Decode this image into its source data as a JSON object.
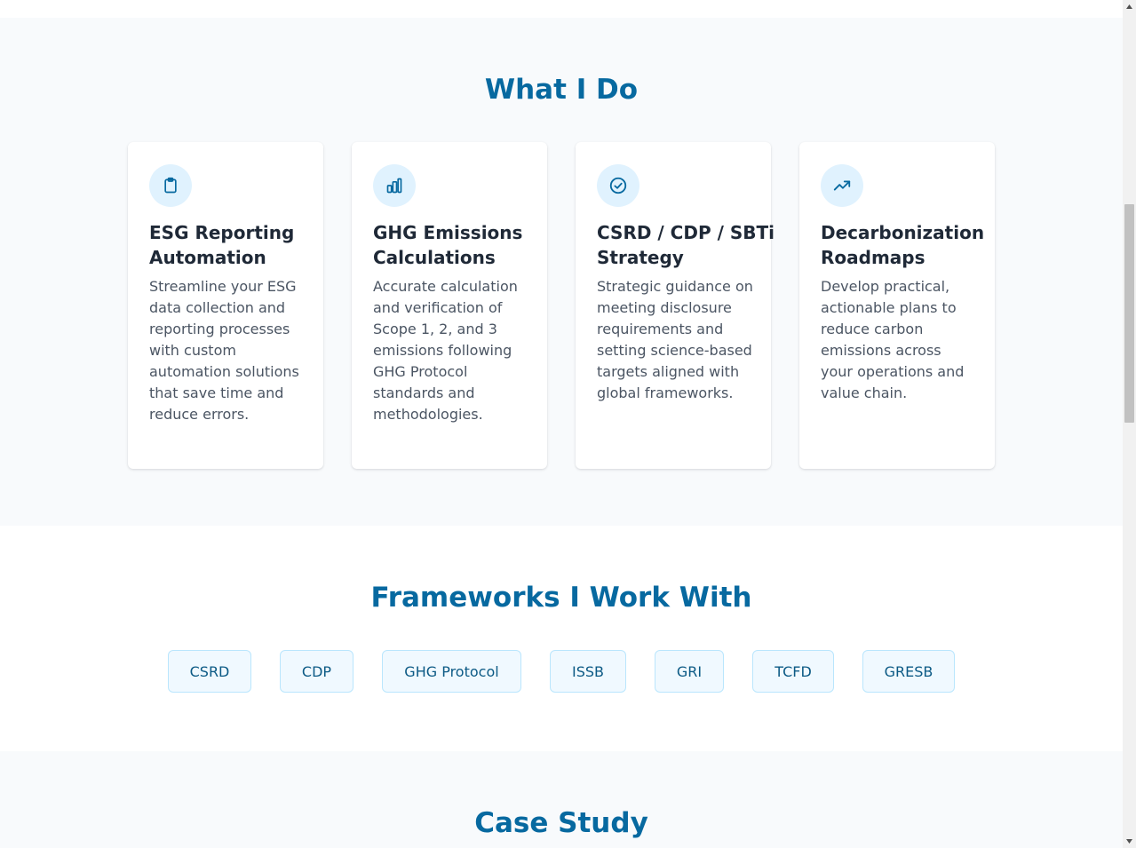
{
  "services": {
    "title": "What I Do",
    "cards": [
      {
        "icon": "clipboard-icon",
        "title": "ESG Reporting Automation",
        "description": "Streamline your ESG data collection and reporting processes with custom automation solutions that save time and reduce errors."
      },
      {
        "icon": "bar-chart-icon",
        "title": "GHG Emissions Calculations",
        "description": "Accurate calculation and verification of Scope 1, 2, and 3 emissions following GHG Protocol standards and methodologies."
      },
      {
        "icon": "check-circle-icon",
        "title": "CSRD / CDP / SBTi Strategy",
        "description": "Strategic guidance on meeting disclosure requirements and setting science-based targets aligned with global frameworks."
      },
      {
        "icon": "trending-up-icon",
        "title": "Decarbonization Roadmaps",
        "description": "Develop practical, actionable plans to reduce carbon emissions across your operations and value chain."
      }
    ]
  },
  "frameworks": {
    "title": "Frameworks I Work With",
    "items": [
      "CSRD",
      "CDP",
      "GHG Protocol",
      "ISSB",
      "GRI",
      "TCFD",
      "GRESB"
    ]
  },
  "case_study": {
    "title": "Case Study"
  },
  "colors": {
    "accent": "#0769a0",
    "icon_bg": "#e0f2fe",
    "chip_bg": "#f0f9ff",
    "chip_border": "#bae6fd",
    "section_bg": "#f8fafc"
  }
}
